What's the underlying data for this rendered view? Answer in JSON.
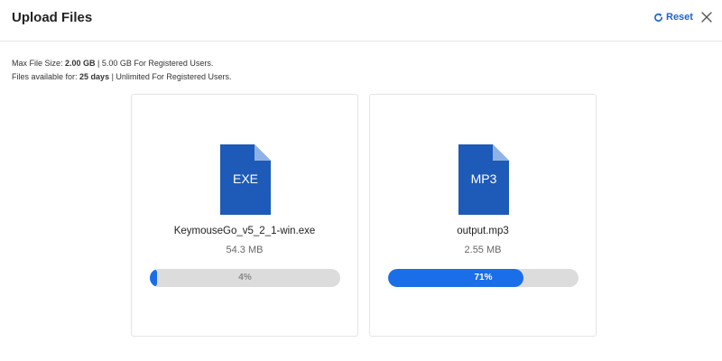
{
  "header": {
    "title": "Upload Files",
    "reset_label": "Reset"
  },
  "info": {
    "line1_prefix": "Max File Size: ",
    "line1_value": "2.00 GB",
    "line1_suffix": " | 5.00 GB For Registered Users.",
    "line2_prefix": "Files available for: ",
    "line2_value": "25 days",
    "line2_suffix": " | Unlimited For Registered Users."
  },
  "files": [
    {
      "ext": "EXE",
      "name": "KeymouseGo_v5_2_1-win.exe",
      "size": "54.3 MB",
      "progress": 0.04,
      "progress_label": "4%"
    },
    {
      "ext": "MP3",
      "name": "output.mp3",
      "size": "2.55 MB",
      "progress": 0.71,
      "progress_label": "71%"
    }
  ],
  "colors": {
    "accent": "#1a6fe8",
    "file_icon": "#1e5bb8",
    "file_fold": "#8fb2e6",
    "track": "#dcdcdc"
  }
}
